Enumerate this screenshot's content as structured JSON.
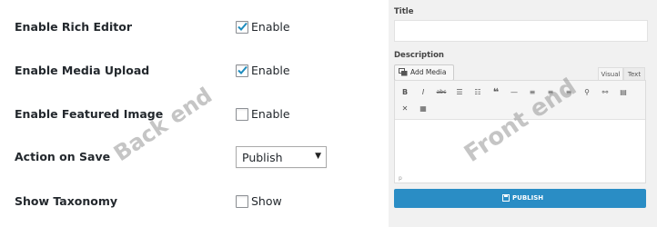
{
  "back_end": {
    "watermark": "Back end",
    "rows": [
      {
        "label": "Enable Rich Editor",
        "control_text": "Enable",
        "checked": true
      },
      {
        "label": "Enable Media Upload",
        "control_text": "Enable",
        "checked": true
      },
      {
        "label": "Enable Featured Image",
        "control_text": "Enable",
        "checked": false
      },
      {
        "label": "Action on Save",
        "select_value": "Publish"
      },
      {
        "label": "Show Taxonomy",
        "control_text": "Show",
        "checked": false
      }
    ]
  },
  "front_end": {
    "watermark": "Front end",
    "title_label": "Title",
    "description_label": "Description",
    "add_media_label": "Add Media",
    "tab_visual": "Visual",
    "tab_text": "Text",
    "path_text": "p",
    "publish_label": "PUBLISH",
    "colors": {
      "publish": "#2a8dc5",
      "panel_bg": "#f1f1f1"
    }
  }
}
